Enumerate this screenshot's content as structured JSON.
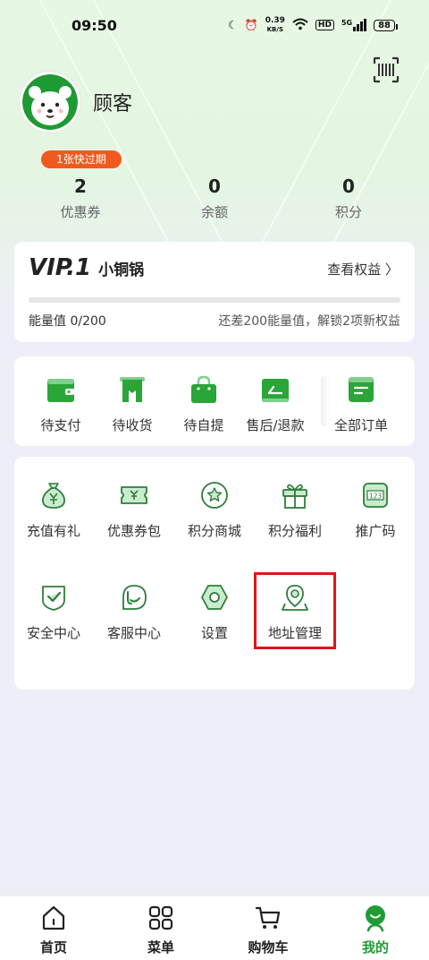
{
  "status_bar": {
    "time": "09:50",
    "speed": "0.39",
    "speed_unit": "KB/S",
    "hd": "HD",
    "signal": "5G",
    "battery": "88"
  },
  "profile": {
    "username": "顾客"
  },
  "stats": {
    "expire_badge": "1张快过期",
    "items": [
      {
        "value": "2",
        "label": "优惠券"
      },
      {
        "value": "0",
        "label": "余额"
      },
      {
        "value": "0",
        "label": "积分"
      }
    ]
  },
  "vip": {
    "level": "VIP.1",
    "name": "小铜锅",
    "link": "查看权益 〉",
    "energy": "能量值 0/200",
    "hint": "还差200能量值，解锁2项新权益",
    "progress": 0
  },
  "orders": [
    {
      "label": "待支付",
      "icon": "wallet-icon"
    },
    {
      "label": "待收货",
      "icon": "bookmark-icon"
    },
    {
      "label": "待自提",
      "icon": "shopping-bag-icon"
    },
    {
      "label": "售后/退款",
      "icon": "return-icon"
    },
    {
      "label": "全部订单",
      "icon": "order-list-icon"
    }
  ],
  "services": [
    {
      "label": "充值有礼",
      "icon": "money-bag-icon"
    },
    {
      "label": "优惠券包",
      "icon": "coupon-icon"
    },
    {
      "label": "积分商城",
      "icon": "star-badge-icon"
    },
    {
      "label": "积分福利",
      "icon": "gift-icon"
    },
    {
      "label": "推广码",
      "icon": "code-icon",
      "code_text": "123"
    },
    {
      "label": "安全中心",
      "icon": "shield-icon"
    },
    {
      "label": "客服中心",
      "icon": "chat-icon"
    },
    {
      "label": "设置",
      "icon": "settings-icon"
    },
    {
      "label": "地址管理",
      "icon": "location-icon"
    }
  ],
  "tabbar": [
    {
      "label": "首页",
      "icon": "home-icon"
    },
    {
      "label": "菜单",
      "icon": "menu-grid-icon"
    },
    {
      "label": "购物车",
      "icon": "cart-icon"
    },
    {
      "label": "我的",
      "icon": "profile-icon",
      "active": true
    }
  ],
  "colors": {
    "brand_green": "#2aa537",
    "badge_orange": "#f05a1e",
    "highlight_red": "#e3131c"
  }
}
